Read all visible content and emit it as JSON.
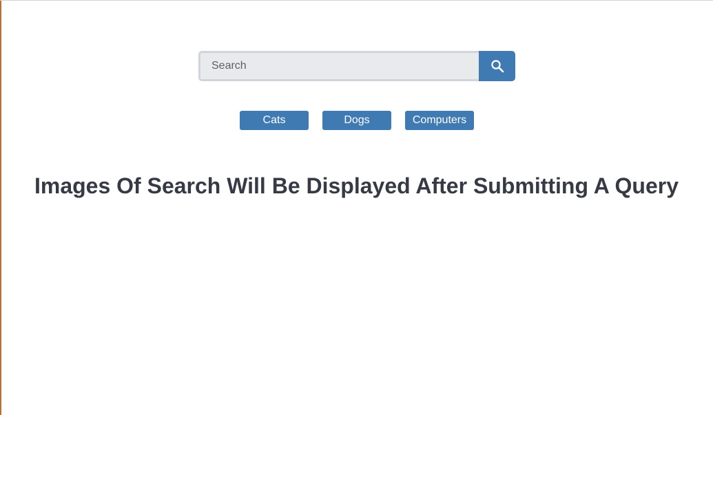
{
  "search": {
    "placeholder": "Search",
    "value": "",
    "button_icon": "magnifier-icon"
  },
  "quick_searches": [
    {
      "label": "Cats"
    },
    {
      "label": "Dogs"
    },
    {
      "label": "Computers"
    }
  ],
  "main": {
    "heading": "Images Of Search Will Be Displayed After Submitting A Query"
  },
  "colors": {
    "accent": "#3f7ab2",
    "input_background": "#e9eaec",
    "input_border": "#d1d5db",
    "heading_text": "#353a44"
  }
}
